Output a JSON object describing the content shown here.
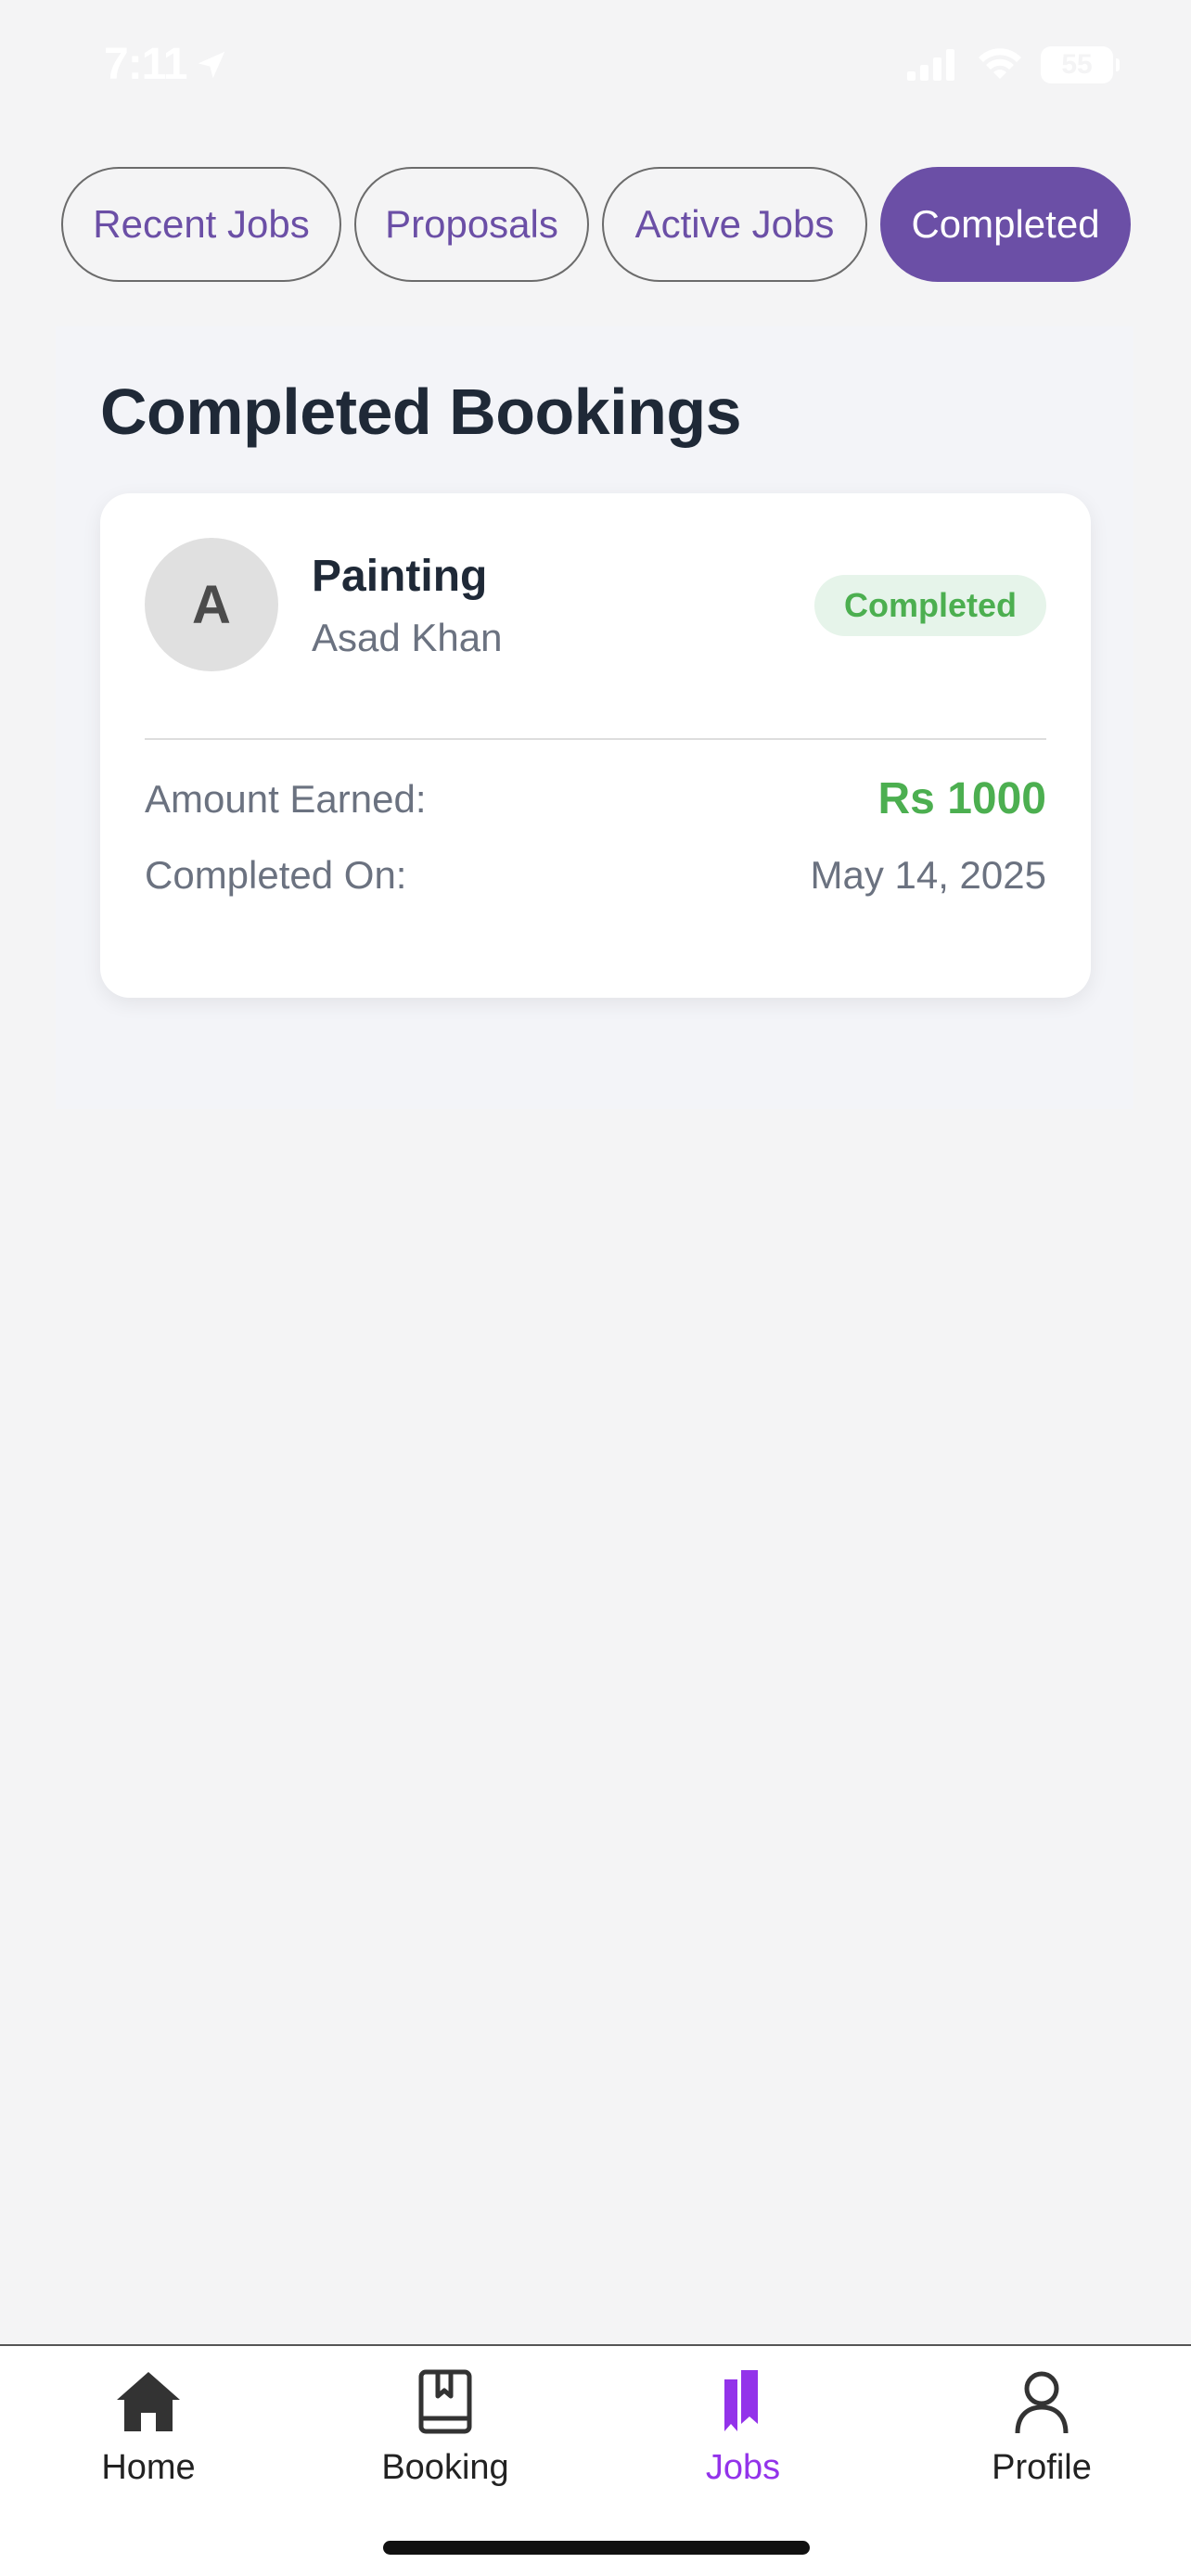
{
  "status_bar": {
    "time": "7:11",
    "battery": "55"
  },
  "tabs": [
    {
      "label": "Recent Jobs",
      "active": false
    },
    {
      "label": "Proposals",
      "active": false
    },
    {
      "label": "Active Jobs",
      "active": false
    },
    {
      "label": "Completed",
      "active": true
    }
  ],
  "section": {
    "title": "Completed Bookings"
  },
  "bookings": [
    {
      "avatar_initial": "A",
      "service": "Painting",
      "client": "Asad Khan",
      "status": "Completed",
      "amount_label": "Amount Earned:",
      "amount_value": "Rs 1000",
      "date_label": "Completed On:",
      "date_value": "May 14, 2025"
    }
  ],
  "bottom_nav": [
    {
      "label": "Home",
      "icon": "home-icon",
      "active": false
    },
    {
      "label": "Booking",
      "icon": "book-icon",
      "active": false
    },
    {
      "label": "Jobs",
      "icon": "bookmarks-icon",
      "active": true
    },
    {
      "label": "Profile",
      "icon": "person-icon",
      "active": false
    }
  ],
  "colors": {
    "accent": "#6b4fa6",
    "success": "#4caf50",
    "active_nav": "#9333ea"
  }
}
